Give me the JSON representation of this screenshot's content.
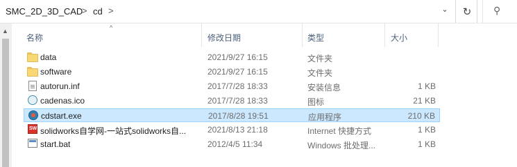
{
  "address": {
    "crumbs": [
      "SMC_2D_3D_CAD",
      "cd"
    ],
    "separator": ">",
    "dropdown_glyph": "⌄",
    "refresh_glyph": "↻",
    "search_glyph": "⚲"
  },
  "columns": {
    "name": "名称",
    "modified": "修改日期",
    "type": "类型",
    "size": "大小"
  },
  "files": [
    {
      "name": "data",
      "date": "2021/9/27 16:15",
      "type": "文件夹",
      "size": "",
      "icon": "folder-icon",
      "selected": false
    },
    {
      "name": "software",
      "date": "2021/9/27 16:15",
      "type": "文件夹",
      "size": "",
      "icon": "folder-icon",
      "selected": false
    },
    {
      "name": "autorun.inf",
      "date": "2017/7/28 18:33",
      "type": "安装信息",
      "size": "1 KB",
      "icon": "setup-info-icon",
      "selected": false
    },
    {
      "name": "cadenas.ico",
      "date": "2017/7/28 18:33",
      "type": "图标",
      "size": "21 KB",
      "icon": "ico-file-icon",
      "selected": false
    },
    {
      "name": "cdstart.exe",
      "date": "2017/8/28 19:51",
      "type": "应用程序",
      "size": "210 KB",
      "icon": "application-icon",
      "selected": true
    },
    {
      "name": "solidworks自学网-一站式solidworks自...",
      "date": "2021/8/13 21:18",
      "type": "Internet 快捷方式",
      "size": "1 KB",
      "icon": "internet-shortcut-icon",
      "selected": false
    },
    {
      "name": "start.bat",
      "date": "2012/4/5 11:34",
      "type": "Windows 批处理...",
      "size": "1 KB",
      "icon": "batch-file-icon",
      "selected": false
    }
  ],
  "colors": {
    "selection_bg": "#cce8ff",
    "selection_border": "#99d1ff",
    "header_text": "#4c607a"
  }
}
